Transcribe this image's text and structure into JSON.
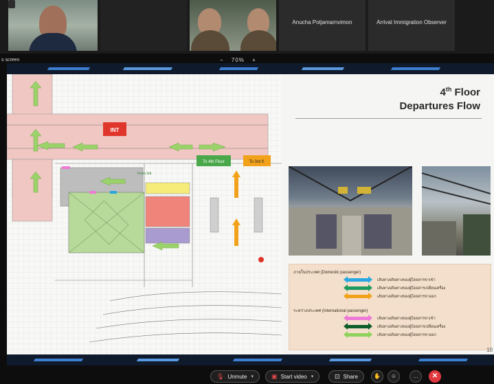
{
  "meeting": {
    "participants": [
      {
        "name": ""
      },
      {
        "name": ""
      },
      {
        "name": ""
      },
      {
        "name": "Anucha Potjamarnvimon"
      },
      {
        "name": "Arrival Immigration Observer"
      }
    ],
    "screen_label": "s screen",
    "zoom": {
      "minus": "−",
      "level": "70%",
      "plus": "+"
    }
  },
  "slide": {
    "title_pre": "4",
    "title_sup": "th",
    "title_line1_rest": " Floor",
    "title_line2": "Departures Flow",
    "page_number": "10",
    "plan_labels": {
      "int": "INT",
      "to_4th_floor": "To 4th Floor",
      "to_3rd_fl": "To 3rd fl.",
      "from_3rd": "From 3rd"
    },
    "legend": {
      "domestic_header": "ภายในประเทศ (Domestic passenger)",
      "international_header": "ระหว่างประเทศ (International passenger)",
      "domestic_rows": [
        {
          "color": "#29a8e0",
          "text": "เส้นทางเดินทางของผู้โดยสารขาเข้า"
        },
        {
          "color": "#1f9a5e",
          "text": "เส้นทางเดินทางของผู้โดยสารเปลี่ยนเครื่อง"
        },
        {
          "color": "#f2a21a",
          "text": "เส้นทางเดินทางของผู้โดยสารขาออก"
        }
      ],
      "international_rows": [
        {
          "color": "#ee7ad6",
          "text": "เส้นทางเดินทางของผู้โดยสารขาเข้า"
        },
        {
          "color": "#0f5d2a",
          "text": "เส้นทางเดินทางของผู้โดยสารเปลี่ยนเครื่อง"
        },
        {
          "color": "#8fd35c",
          "text": "เส้นทางเดินทางของผู้โดยสารขาออก"
        }
      ]
    }
  },
  "toolbar": {
    "unmute": "Unmute",
    "start_video": "Start video",
    "share": "Share",
    "leave": "✕"
  }
}
